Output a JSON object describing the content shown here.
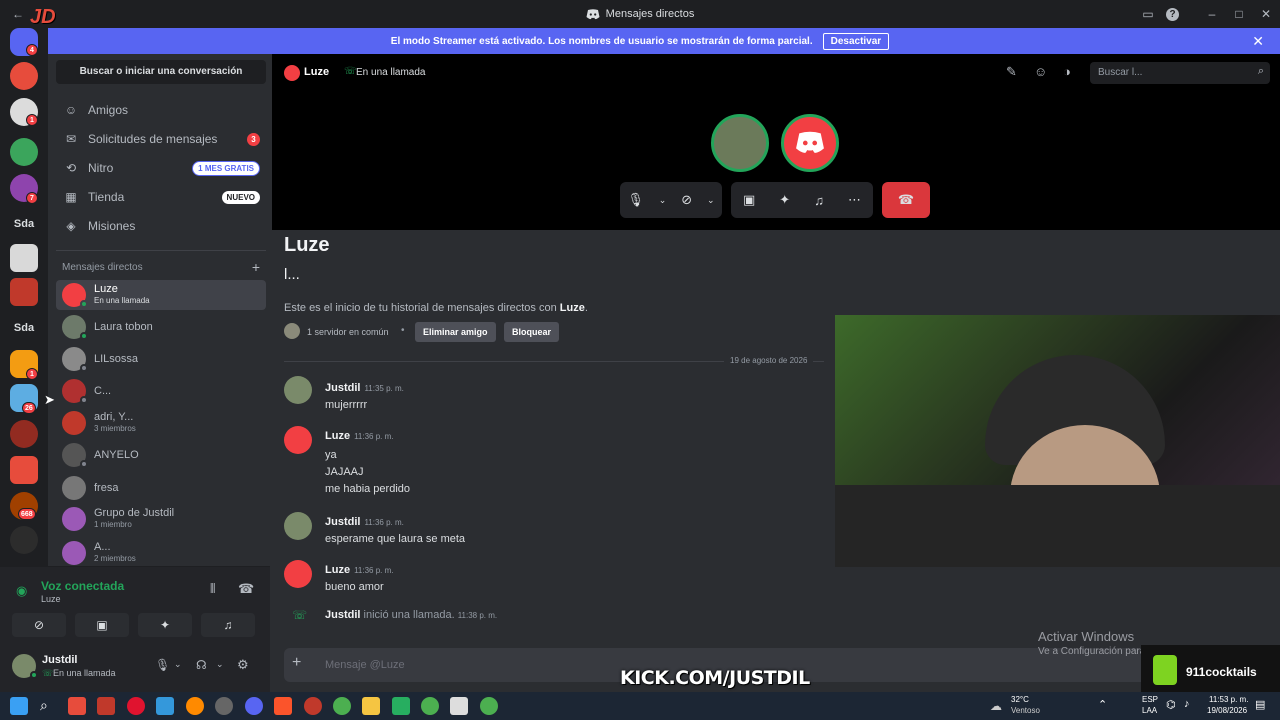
{
  "window": {
    "title": "Mensajes directos"
  },
  "banner": {
    "text": "El modo Streamer está activado. Los nombres de usuario se mostrarán de forma parcial.",
    "button": "Desactivar"
  },
  "rail": {
    "badges": [
      "4",
      "1",
      "7",
      "1",
      "26",
      "668"
    ],
    "text_servers": [
      "Sda",
      "Sda"
    ]
  },
  "sidebar": {
    "search": "Buscar o iniciar una conversación",
    "nav": [
      {
        "label": "Amigos"
      },
      {
        "label": "Solicitudes de mensajes",
        "badge": "3"
      },
      {
        "label": "Nitro",
        "pill": "1 MES GRATIS"
      },
      {
        "label": "Tienda",
        "pill": "NUEVO"
      },
      {
        "label": "Misiones"
      }
    ],
    "dm_header": "Mensajes directos",
    "dms": [
      {
        "name": "Luze",
        "sub": "En una llamada"
      },
      {
        "name": "Laura tobon",
        "sub": ""
      },
      {
        "name": "LILsossa",
        "sub": ""
      },
      {
        "name": "C...",
        "sub": ""
      },
      {
        "name": "adri, Y...",
        "sub": "3 miembros"
      },
      {
        "name": "ANYELO",
        "sub": ""
      },
      {
        "name": "fresa",
        "sub": ""
      },
      {
        "name": "Grupo de Justdil",
        "sub": "1 miembro"
      },
      {
        "name": "A...",
        "sub": "2 miembros"
      }
    ]
  },
  "voice": {
    "status": "Voz conectada",
    "channel": "Luze"
  },
  "user": {
    "name": "Justdil",
    "status": "En una llamada"
  },
  "header": {
    "name": "Luze",
    "call_status": "En una llamada",
    "search_placeholder": "Buscar l..."
  },
  "chat": {
    "title": "Luze",
    "subtitle": "l...",
    "intro_prefix": "Este es el inicio de tu historial de mensajes directos con ",
    "intro_name": "Luze",
    "intro_suffix": ".",
    "mutual": "1 servidor en común",
    "remove_friend": "Eliminar amigo",
    "block": "Bloquear",
    "date_divider": "19 de agosto de 2026",
    "messages": [
      {
        "author": "Justdil",
        "time": "11:35 p. m.",
        "lines": [
          "mujerrrrr"
        ]
      },
      {
        "author": "Luze",
        "time": "11:36 p. m.",
        "lines": [
          "ya",
          "JAJAAJ",
          "me habia perdido"
        ]
      },
      {
        "author": "Justdil",
        "time": "11:36 p. m.",
        "lines": [
          "esperame que laura se meta"
        ]
      },
      {
        "author": "Luze",
        "time": "11:36 p. m.",
        "lines": [
          "bueno amor"
        ]
      }
    ],
    "call_event": {
      "author": "Justdil",
      "text": "inició una llamada.",
      "time": "11:38 p. m."
    },
    "input_placeholder": "Mensaje @Luze"
  },
  "overlay": {
    "activate_title": "Activar Windows",
    "activate_sub": "Ve a Configuración para",
    "kick": "KICK.COM/JUSTDIL",
    "cocktails": "911cocktails",
    "jd_logo": "JD"
  },
  "taskbar": {
    "temp": "32°C",
    "weather": "Ventoso",
    "lang1": "ESP",
    "lang2": "LAA",
    "time": "11:53 p. m.",
    "date": "19/08/2026"
  },
  "colors": {
    "accent": "#5865f2",
    "green": "#23a55a",
    "red": "#da373c",
    "bg": "#2b2d31"
  }
}
